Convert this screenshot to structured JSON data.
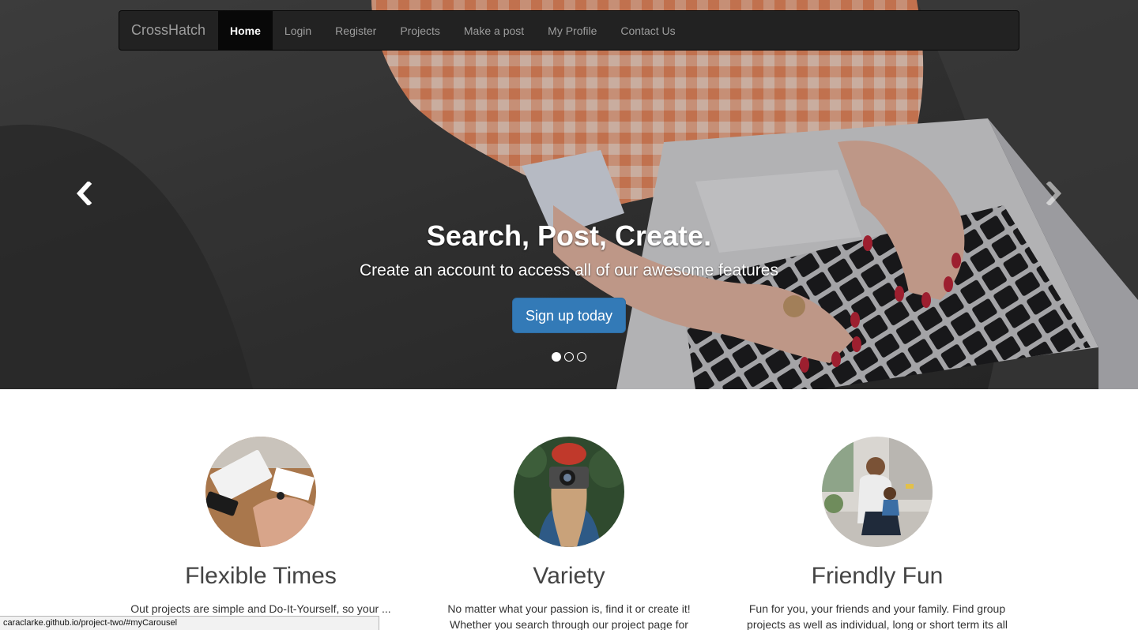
{
  "navbar": {
    "brand": "CrossHatch",
    "items": [
      {
        "label": "Home",
        "active": true
      },
      {
        "label": "Login",
        "active": false
      },
      {
        "label": "Register",
        "active": false
      },
      {
        "label": "Projects",
        "active": false
      },
      {
        "label": "Make a post",
        "active": false
      },
      {
        "label": "My Profile",
        "active": false
      },
      {
        "label": "Contact Us",
        "active": false
      }
    ]
  },
  "carousel": {
    "heading": "Search, Post, Create.",
    "subheading": "Create an account to access all of our awesome features",
    "button_label": "Sign up today",
    "prev_icon": "chevron-left-icon",
    "next_icon": "chevron-right-icon",
    "slide_count": 3,
    "active_slide": 1
  },
  "features": [
    {
      "title": "Flexible Times",
      "text": "Out projects are simple and Do-It-Yourself, so your ... ght",
      "image": "desk-workspace-photo"
    },
    {
      "title": "Variety",
      "text": "No matter what your passion is, find it or create it! Whether you search through our project page for",
      "image": "photographer-camera-photo"
    },
    {
      "title": "Friendly Fun",
      "text": "Fun for you, your friends and your family. Find group projects as well as individual, long or short term its all",
      "image": "mother-child-street-photo"
    }
  ],
  "status_bar": {
    "url": "caraclarke.github.io/project-two/#myCarousel"
  },
  "colors": {
    "navbar_bg": "#222222",
    "nav_active_bg": "#080808",
    "primary_button": "#337ab7"
  }
}
